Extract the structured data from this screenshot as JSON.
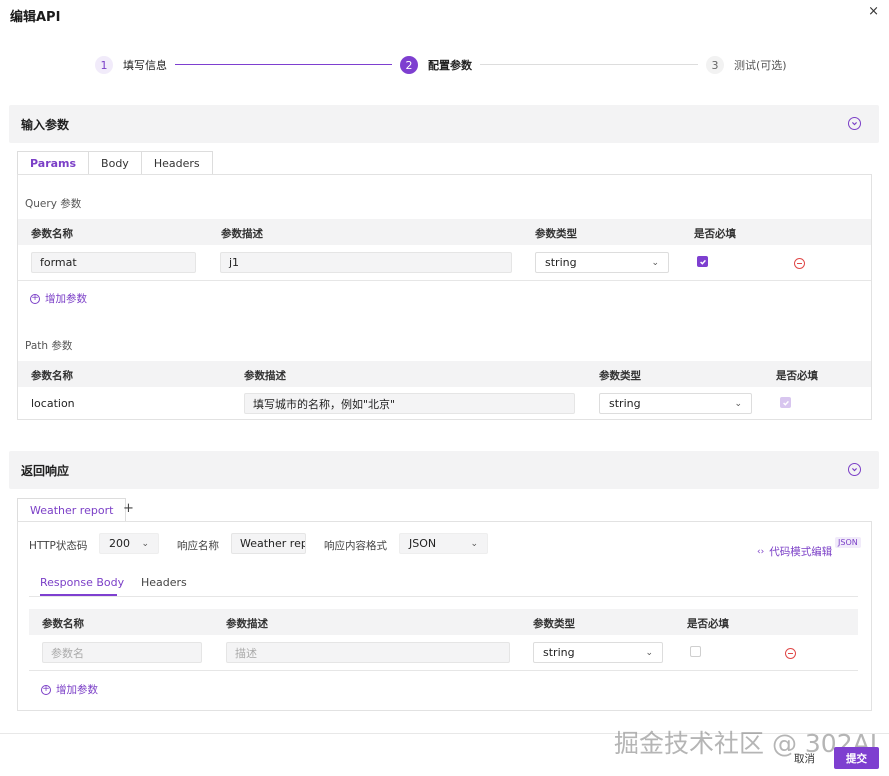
{
  "modal": {
    "title": "编辑API",
    "close": "×"
  },
  "steps": [
    {
      "num": "1",
      "label": "填写信息",
      "state": "done"
    },
    {
      "num": "2",
      "label": "配置参数",
      "state": "active"
    },
    {
      "num": "3",
      "label": "测试(可选)",
      "state": "todo"
    }
  ],
  "input_section": {
    "title": "输入参数",
    "tabs": [
      "Params",
      "Body",
      "Headers"
    ],
    "query": {
      "title": "Query 参数",
      "headers": [
        "参数名称",
        "参数描述",
        "参数类型",
        "是否必填"
      ],
      "row": {
        "name": "format",
        "desc": "j1",
        "type": "string",
        "required": true
      },
      "add_label": "增加参数"
    },
    "path": {
      "title": "Path 参数",
      "headers": [
        "参数名称",
        "参数描述",
        "参数类型",
        "是否必填"
      ],
      "row": {
        "name": "location",
        "desc": "填写城市的名称，例如\"北京\"",
        "type": "string",
        "required": true
      }
    }
  },
  "response_section": {
    "title": "返回响应",
    "tab": "Weather report",
    "add_tab": "+",
    "http_status_label": "HTTP状态码",
    "http_status_value": "200",
    "resp_name_label": "响应名称",
    "resp_name_value": "Weather rep",
    "content_type_label": "响应内容格式",
    "content_type_value": "JSON",
    "code_mode_label": "代码模式编辑",
    "json_badge": "JSON",
    "sub_tabs": [
      "Response Body",
      "Headers"
    ],
    "headers": [
      "参数名称",
      "参数描述",
      "参数类型",
      "是否必填"
    ],
    "row": {
      "name_placeholder": "参数名",
      "desc_placeholder": "描述",
      "type": "string",
      "required": false
    },
    "add_label": "增加参数"
  },
  "footer": {
    "cancel": "取消",
    "submit": "提交"
  },
  "watermark": "掘金技术社区 @ 302AI",
  "colors": {
    "accent": "#7e3fd0",
    "danger": "#e04848"
  }
}
